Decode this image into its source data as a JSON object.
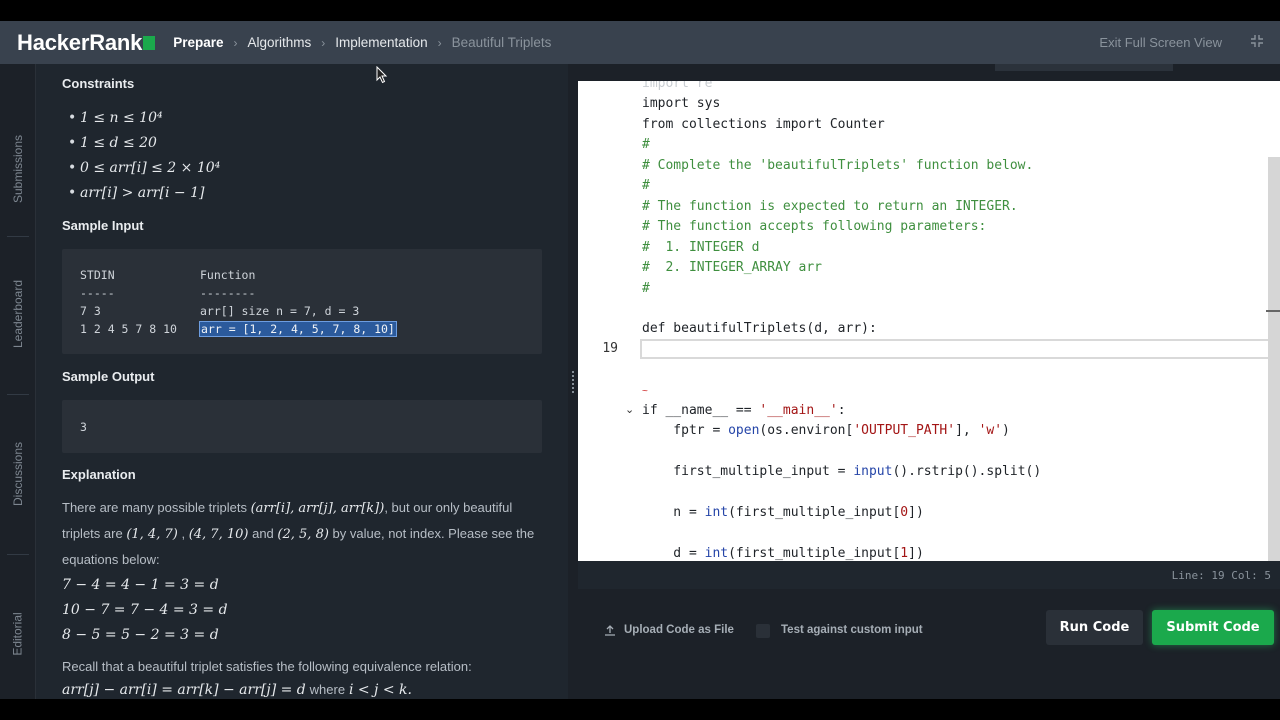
{
  "header": {
    "logo": "HackerRank",
    "breadcrumbs": [
      "Prepare",
      "Algorithms",
      "Implementation",
      "Beautiful Triplets"
    ],
    "exit_fullscreen": "Exit Full Screen View"
  },
  "rail": {
    "items": [
      "Submissions",
      "Leaderboard",
      "Discussions",
      "Editorial"
    ]
  },
  "problem": {
    "constraints_heading": "Constraints",
    "constraints": [
      "1 ≤ n ≤ 10⁴",
      "1 ≤ d ≤ 20",
      "0 ≤ arr[i] ≤ 2 × 10⁴",
      "arr[i] > arr[i − 1]"
    ],
    "sample_input_heading": "Sample Input",
    "sample_input": {
      "col1_header": "STDIN",
      "col2_header": "Function",
      "col1_rule": "-----",
      "col2_rule": "--------",
      "row1_col1": "7 3",
      "row1_col2": "arr[] size n = 7, d = 3",
      "row2_col1": "1 2 4 5 7 8 10",
      "row2_col2": "arr = [1, 2, 4, 5, 7, 8, 10]"
    },
    "sample_output_heading": "Sample Output",
    "sample_output": "3",
    "explanation_heading": "Explanation",
    "explanation_p1_a": "There are many possible triplets",
    "explanation_p1_math1": "(arr[i], arr[j], arr[k])",
    "explanation_p1_b": ", but our only beautiful triplets are",
    "explanation_p1_math2": "(1, 4, 7)",
    "explanation_p1_c": ",",
    "explanation_p1_math3": "(4, 7, 10)",
    "explanation_p1_d": "and",
    "explanation_p1_math4": "(2, 5, 8)",
    "explanation_p1_e": "by value, not index. Please see the equations below:",
    "equations": [
      "7 − 4 = 4 − 1 = 3 = d",
      "10 − 7 = 7 − 4 = 3 = d",
      "8 − 5 = 5 − 2 = 3 = d"
    ],
    "recall": "Recall that a beautiful triplet satisfies the following equivalence relation:",
    "relation_math": "arr[j] − arr[i] = arr[k] − arr[j] = d",
    "relation_where": "where",
    "relation_cond": "i < j < k."
  },
  "editor": {
    "active_line_number": "19",
    "lines": {
      "partial_top": "import re",
      "l1": "import sys",
      "l2_a": "from",
      "l2_b": " collections ",
      "l2_c": "import",
      "l2_d": " Counter",
      "c1": "#",
      "c2": "# Complete the 'beautifulTriplets' function below.",
      "c3": "#",
      "c4": "# The function is expected to return an INTEGER.",
      "c5": "# The function accepts following parameters:",
      "c6": "#  1. INTEGER d",
      "c7": "#  2. INTEGER_ARRAY arr",
      "c8": "#",
      "def_kw": "def",
      "def_rest": " beautifulTriplets(d, arr):",
      "if_kw": "if",
      "if_rest": " __name__ == ",
      "if_str": "'__main__'",
      "if_colon": ":",
      "fptr_a": "    fptr = ",
      "fptr_open": "open",
      "fptr_b": "(os.environ[",
      "fptr_s1": "'OUTPUT_PATH'",
      "fptr_c": "], ",
      "fptr_s2": "'w'",
      "fptr_d": ")",
      "fmi_a": "    first_multiple_input = ",
      "fmi_input": "input",
      "fmi_b": "().rstrip().split()",
      "n_a": "    n = ",
      "n_int": "int",
      "n_b": "(first_multiple_input[",
      "n_idx": "0",
      "n_c": "])",
      "d_a": "    d = ",
      "d_int": "int",
      "d_b": "(first_multiple_input[",
      "d_idx": "1",
      "d_c": "])"
    },
    "status": "Line: 19 Col: 5"
  },
  "actions": {
    "upload": "Upload Code as File",
    "custom_input": "Test against custom input",
    "run": "Run Code",
    "submit": "Submit Code"
  },
  "colors": {
    "header_bg": "#39424e",
    "brand_green": "#1ba94c",
    "panel_bg": "#1f262e",
    "comment": "#3f8f3f"
  }
}
